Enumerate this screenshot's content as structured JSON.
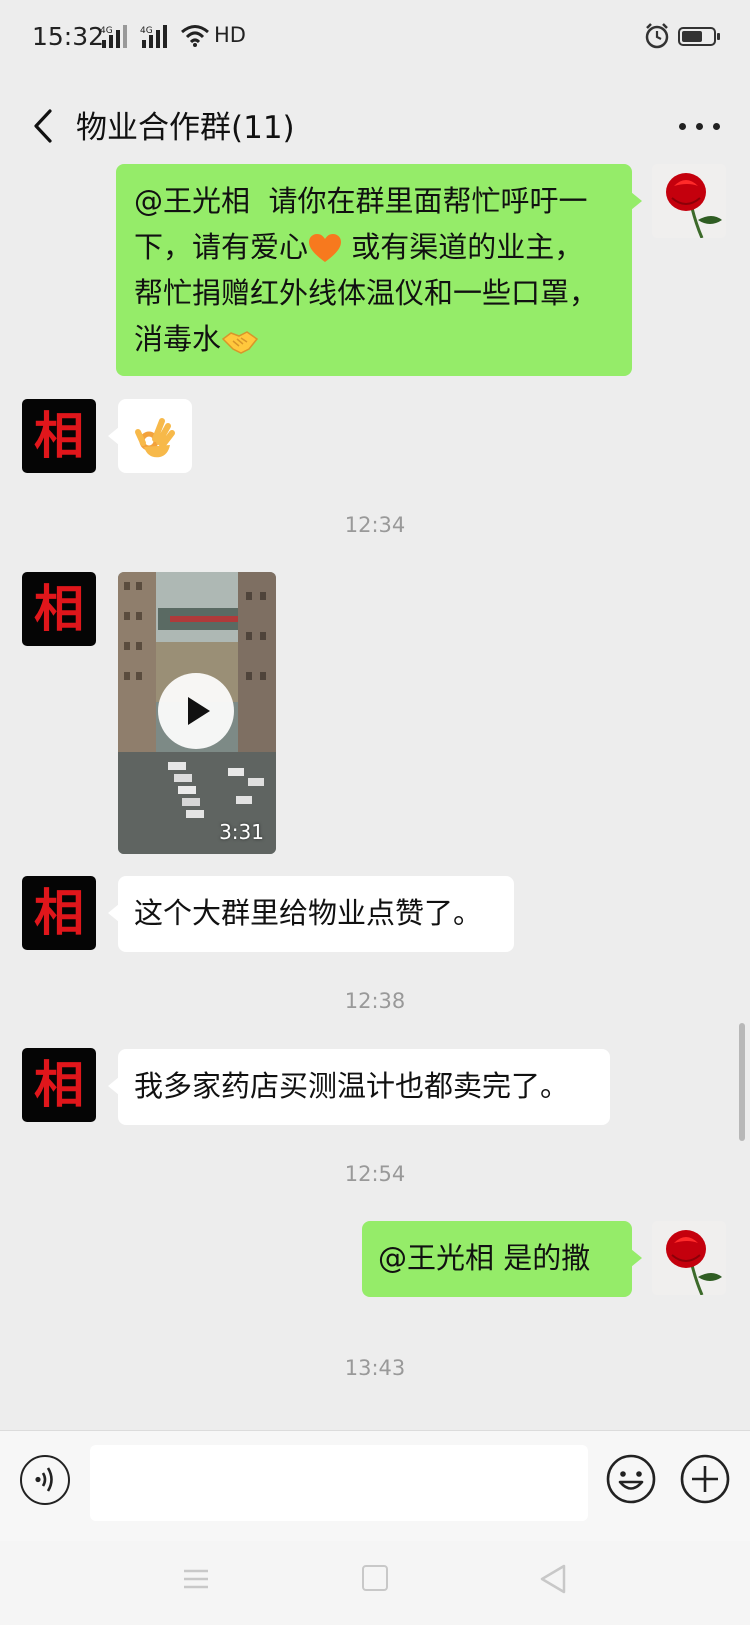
{
  "status_bar": {
    "time": "15:32",
    "network_1": "4G",
    "network_2": "4G",
    "hd_label": "HD",
    "battery_level": 0.7
  },
  "header": {
    "title": "物业合作群(11)"
  },
  "messages": [
    {
      "sender": "self",
      "mention": "@王光相",
      "text_1": "请你在群里面帮忙呼吁一",
      "text_2": "下，请有爱心",
      "text_3": "或有渠道的业主，",
      "text_4": "帮忙捐赠红外线体温仪和一些口罩，",
      "text_5": "消毒水",
      "emojis": [
        "orange-heart-emoji",
        "handshake-emoji"
      ]
    },
    {
      "sender": "other",
      "avatar_char": "相",
      "emoji": "ok-hand-emoji"
    },
    {
      "type": "timestamp",
      "time": "12:34"
    },
    {
      "sender": "other",
      "avatar_char": "相",
      "type": "video",
      "duration": "3:31"
    },
    {
      "sender": "other",
      "avatar_char": "相",
      "text": "这个大群里给物业点赞了。"
    },
    {
      "type": "timestamp",
      "time": "12:38"
    },
    {
      "sender": "other",
      "avatar_char": "相",
      "text": "我多家药店买测温计也都卖完了。"
    },
    {
      "type": "timestamp",
      "time": "12:54"
    },
    {
      "sender": "self",
      "text": "@王光相  是的撒"
    },
    {
      "type": "timestamp",
      "time": "13:43"
    }
  ],
  "input": {
    "value": "",
    "placeholder": ""
  },
  "icons": {
    "back": "chevron-left-icon",
    "more": "more-dots-icon",
    "voice": "voice-icon",
    "emoji": "emoji-icon",
    "plus": "plus-icon"
  },
  "colors": {
    "background": "#ededed",
    "self_bubble": "#95ec69",
    "other_bubble": "#ffffff",
    "avatar_char": "#e0161b"
  }
}
